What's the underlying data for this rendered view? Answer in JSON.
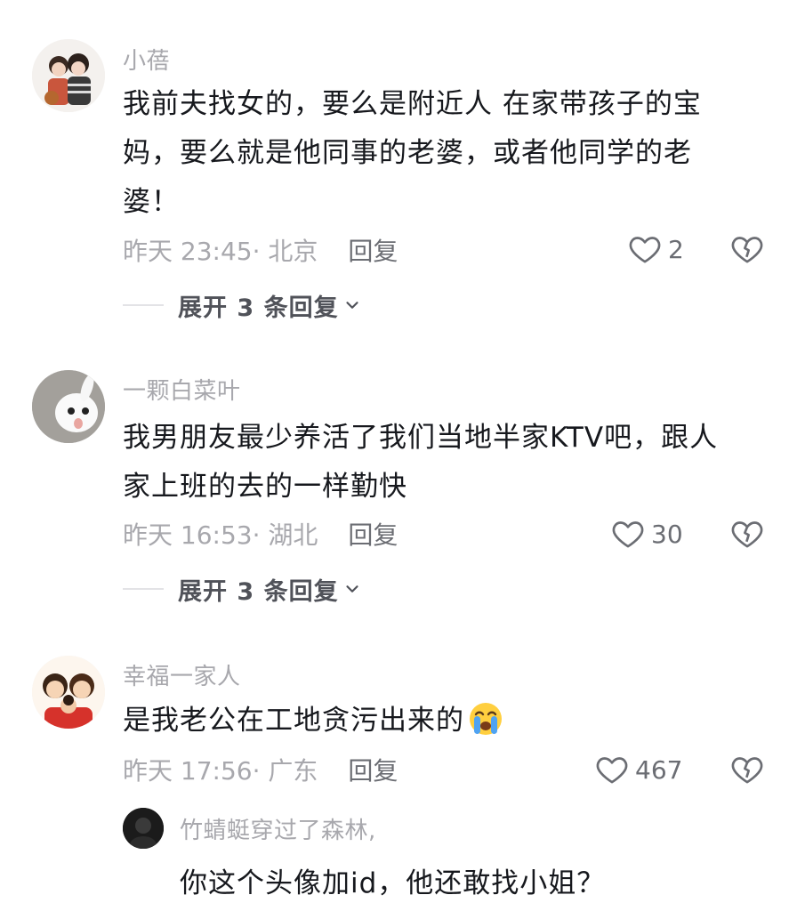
{
  "comments": [
    {
      "username": "小蓓",
      "avatar_icon": "couple-avatar",
      "lines": [
        "我前夫找女的，要么是附近人 在家带孩子的宝",
        "妈，要么就是他同事的老婆，或者他同学的老",
        "婆！"
      ],
      "time": "昨天 23:45· 北京",
      "reply_label": "回复",
      "likes": "2",
      "expand_label": "展开 3 条回复"
    },
    {
      "username": "一颗白菜叶",
      "avatar_icon": "rabbit-avatar",
      "lines": [
        "我男朋友最少养活了我们当地半家KTV吧，跟人",
        "家上班的去的一样勤快"
      ],
      "time": "昨天 16:53· 湖北",
      "reply_label": "回复",
      "likes": "30",
      "expand_label": "展开 3 条回复"
    },
    {
      "username": "幸福一家人",
      "avatar_icon": "family-avatar",
      "lines": [
        "是我老公在工地贪污出来的"
      ],
      "emoji": "crying-face-emoji",
      "time": "昨天 17:56· 广东",
      "reply_label": "回复",
      "likes": "467"
    }
  ],
  "reply": {
    "username": "竹蜻蜓穿过了森林,",
    "avatar_icon": "dark-avatar",
    "content": "你这个头像加id，他还敢找小姐？"
  },
  "colors": {
    "text": "#16181d",
    "secondary": "#a8a8ad",
    "action": "#6b6d73"
  }
}
